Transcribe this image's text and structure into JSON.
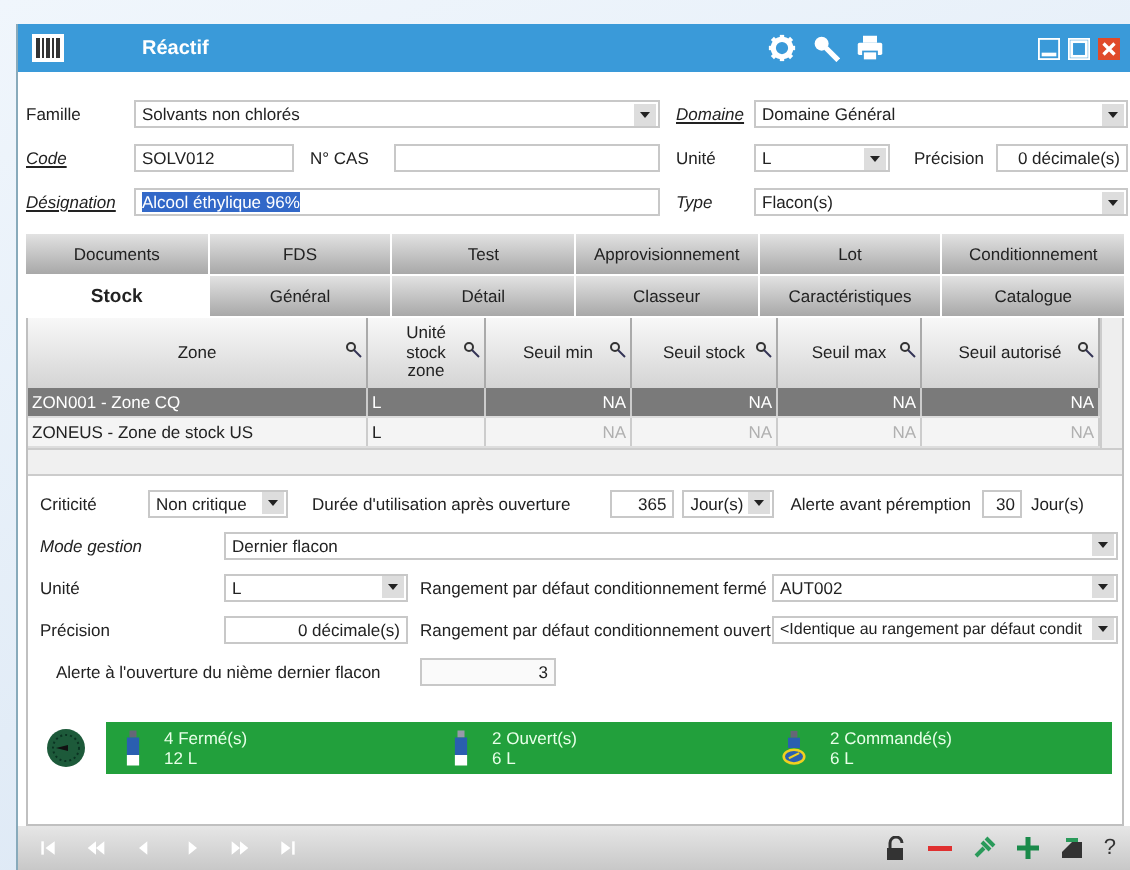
{
  "window": {
    "title": "Réactif"
  },
  "form": {
    "famille": {
      "label": "Famille",
      "kind": "plain",
      "value": "Solvants non chlorés"
    },
    "domaine": {
      "label": "Domaine",
      "kind": "link",
      "value": "Domaine Général"
    },
    "code": {
      "label": "Code",
      "kind": "link",
      "value": "SOLV012"
    },
    "cas": {
      "label": "N° CAS",
      "kind": "plain"
    },
    "unite": {
      "label": "Unité",
      "kind": "plain",
      "value": "L"
    },
    "precision": {
      "label": "Précision",
      "kind": "plain",
      "value": "0 décimale(s)"
    },
    "designation": {
      "label": "Désignation",
      "kind": "link",
      "value": "Alcool éthylique 96%",
      "selected": true
    },
    "type": {
      "label": "Type",
      "kind": "italic",
      "value": "Flacon(s)"
    }
  },
  "tab_rows": [
    {
      "tabs": [
        {
          "label": "Documents",
          "selected": false
        },
        {
          "label": "FDS",
          "selected": false
        },
        {
          "label": "Test",
          "selected": false
        },
        {
          "label": "Approvisionnement",
          "selected": false
        },
        {
          "label": "Lot",
          "selected": false
        },
        {
          "label": "Conditionnement",
          "selected": false
        }
      ]
    },
    {
      "tabs": [
        {
          "label": "Stock",
          "selected": true
        },
        {
          "label": "Général",
          "selected": false
        },
        {
          "label": "Détail",
          "selected": false
        },
        {
          "label": "Classeur",
          "selected": false
        },
        {
          "label": "Caractéristiques",
          "selected": false
        },
        {
          "label": "Catalogue",
          "selected": false
        }
      ]
    }
  ],
  "table": {
    "columns": [
      "Zone",
      "Unité stock zone",
      "Seuil min",
      "Seuil stock",
      "Seuil max",
      "Seuil autorisé"
    ],
    "rows": [
      {
        "selected": true,
        "cells": [
          "ZON001 - Zone CQ",
          "L",
          "NA",
          "NA",
          "NA",
          "NA"
        ]
      },
      {
        "selected": false,
        "cells": [
          "ZONEUS - Zone de stock US",
          "L",
          "NA",
          "NA",
          "NA",
          "NA"
        ]
      }
    ]
  },
  "stock_settings": {
    "criticite": {
      "label": "Criticité",
      "value": "Non critique"
    },
    "duree": {
      "label": "Durée d'utilisation après ouverture",
      "value": "365",
      "unit": "Jour(s)"
    },
    "alerte_peremption": {
      "label": "Alerte avant péremption",
      "value": "30",
      "unit": "Jour(s)"
    },
    "mode_gestion": {
      "label": "Mode gestion",
      "kind": "italic",
      "value": "Dernier flacon"
    },
    "unite": {
      "label": "Unité",
      "value": "L"
    },
    "rangement_ferme": {
      "label": "Rangement par défaut conditionnement fermé",
      "value": "AUT002"
    },
    "precision": {
      "label": "Précision",
      "value": "0 décimale(s)"
    },
    "rangement_ouvert": {
      "label": "Rangement par défaut conditionnement ouvert",
      "value": "<Identique au rangement par défaut condit"
    },
    "alerte_ouverture": {
      "label": "Alerte à l'ouverture du nième dernier flacon",
      "value": "3"
    }
  },
  "stock_summary": [
    {
      "kind": "closed",
      "count": "4 Fermé(s)",
      "quantity": "12 L"
    },
    {
      "kind": "open",
      "count": "2 Ouvert(s)",
      "quantity": "6 L"
    },
    {
      "kind": "ordered",
      "count": "2 Commandé(s)",
      "quantity": "6 L"
    }
  ],
  "toolbar": {
    "help": "?"
  }
}
